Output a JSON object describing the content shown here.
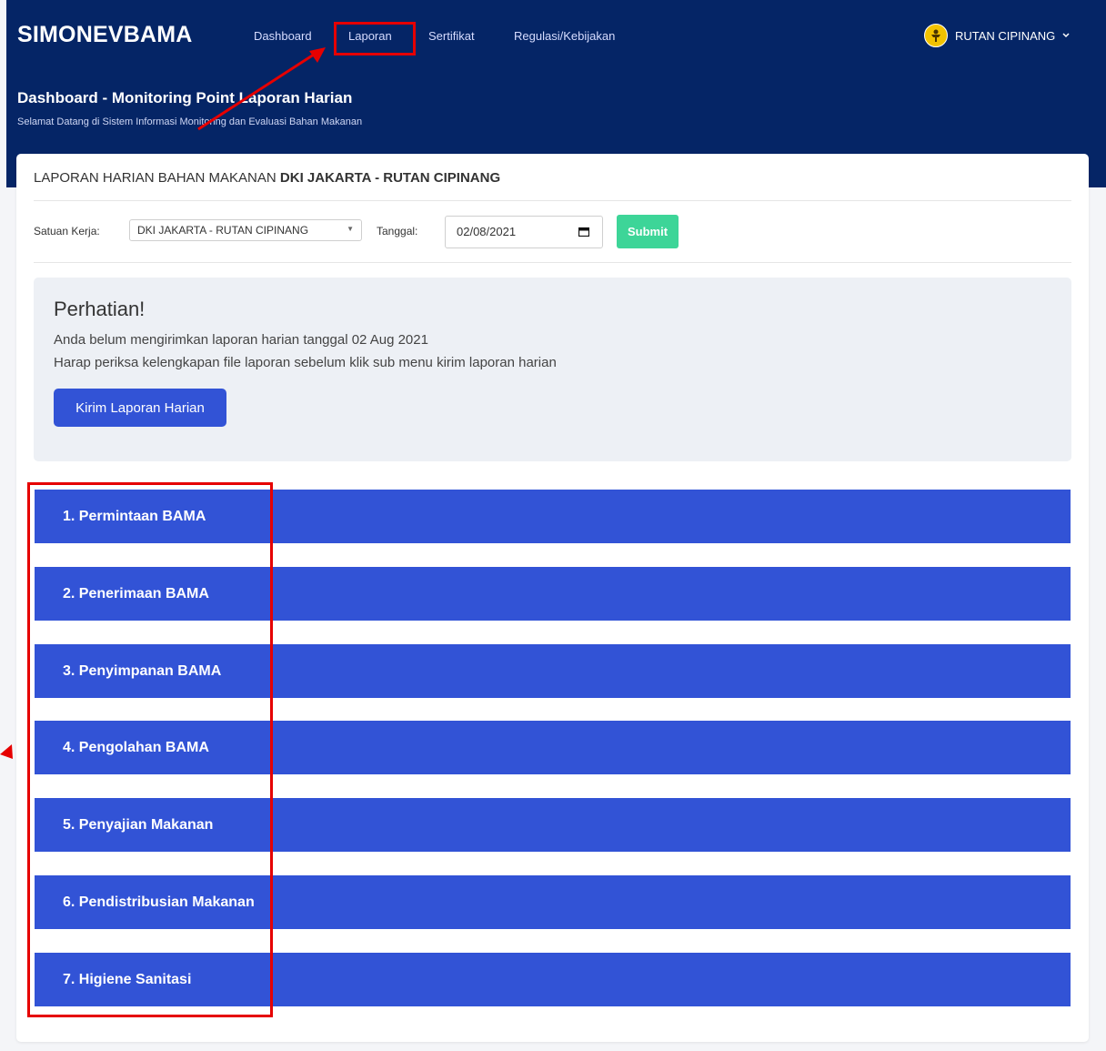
{
  "app": {
    "brand": "SIMONEVBAMA"
  },
  "nav": {
    "items": [
      "Dashboard",
      "Laporan",
      "Sertifikat",
      "Regulasi/Kebijakan"
    ]
  },
  "user": {
    "name": "RUTAN CIPINANG",
    "menu_icon": "chevron-down-icon"
  },
  "header": {
    "title": "Dashboard - Monitoring Point Laporan Harian",
    "subtitle": "Selamat Datang di Sistem Informasi Monitoring dan Evaluasi Bahan Makanan"
  },
  "card": {
    "title_prefix": "LAPORAN HARIAN BAHAN MAKANAN",
    "title_unit": "DKI JAKARTA - RUTAN CIPINANG"
  },
  "form": {
    "satuan_label": "Satuan Kerja:",
    "satuan_value": "DKI JAKARTA - RUTAN CIPINANG",
    "tanggal_label": "Tanggal:",
    "tanggal_value": "02/08/2021",
    "submit_label": "Submit"
  },
  "alert": {
    "heading": "Perhatian!",
    "line1": "Anda belum mengirimkan laporan harian tanggal 02 Aug 2021",
    "line2": "Harap periksa kelengkapan file laporan sebelum klik sub menu kirim laporan harian",
    "button_label": "Kirim Laporan Harian"
  },
  "sections": [
    {
      "label": "1. Permintaan BAMA"
    },
    {
      "label": "2. Penerimaan BAMA"
    },
    {
      "label": "3. Penyimpanan BAMA"
    },
    {
      "label": "4. Pengolahan BAMA"
    },
    {
      "label": "5. Penyajian Makanan"
    },
    {
      "label": "6. Pendistribusian Makanan"
    },
    {
      "label": "7. Higiene Sanitasi"
    }
  ],
  "colors": {
    "header_bg": "#052566",
    "section_bg": "#3253d6",
    "submit_bg": "#3dd598",
    "annotation": "#e60000"
  }
}
